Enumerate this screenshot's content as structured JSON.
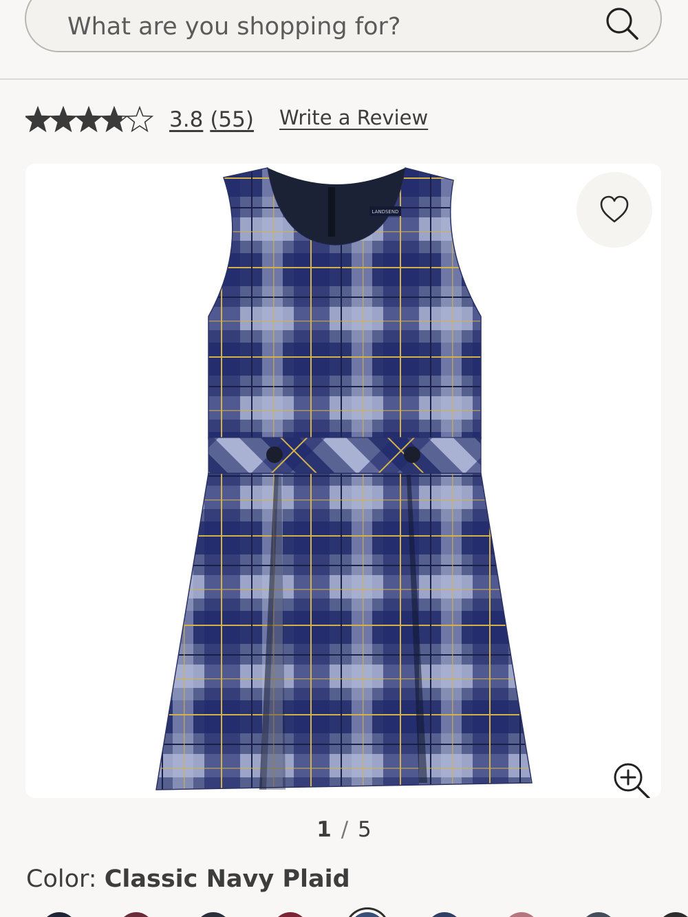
{
  "search": {
    "placeholder": "What are you shopping for?"
  },
  "rating": {
    "value": "3.8",
    "count": "(55)",
    "stars": 3.8,
    "write_review": "Write a Review"
  },
  "product": {
    "brand_tag": "LANDSEND",
    "colors": {
      "navy": "#28326a",
      "light": "#a6afd0",
      "mid": "#56608f",
      "yellow": "#d4b24a"
    }
  },
  "gallery": {
    "current": "1",
    "separator": "/",
    "total": "5"
  },
  "color_selector": {
    "label": "Color:",
    "value": "Classic Navy Plaid",
    "swatches": [
      "#1f2436",
      "#6b2c3a",
      "#2b2f3b",
      "#7a2435",
      "#3a4f78",
      "#2f3f66",
      "#b4757f",
      "#454c5a",
      "#2d2d2d"
    ]
  }
}
